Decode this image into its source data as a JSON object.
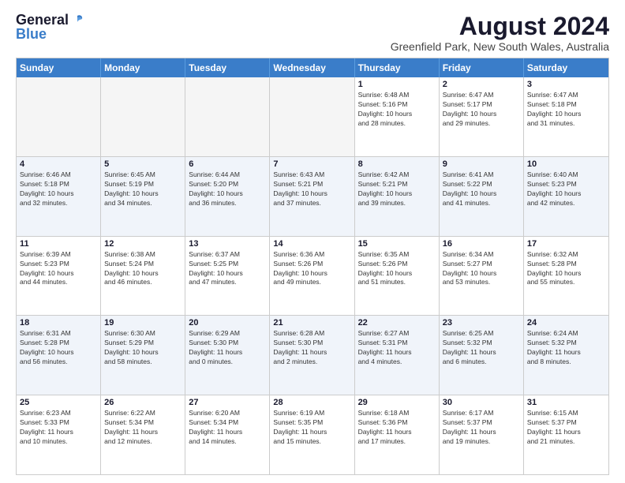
{
  "logo": {
    "general": "General",
    "blue": "Blue"
  },
  "title": "August 2024",
  "subtitle": "Greenfield Park, New South Wales, Australia",
  "headers": [
    "Sunday",
    "Monday",
    "Tuesday",
    "Wednesday",
    "Thursday",
    "Friday",
    "Saturday"
  ],
  "weeks": [
    [
      {
        "day": "",
        "info": "",
        "empty": true
      },
      {
        "day": "",
        "info": "",
        "empty": true
      },
      {
        "day": "",
        "info": "",
        "empty": true
      },
      {
        "day": "",
        "info": "",
        "empty": true
      },
      {
        "day": "1",
        "info": "Sunrise: 6:48 AM\nSunset: 5:16 PM\nDaylight: 10 hours\nand 28 minutes.",
        "empty": false
      },
      {
        "day": "2",
        "info": "Sunrise: 6:47 AM\nSunset: 5:17 PM\nDaylight: 10 hours\nand 29 minutes.",
        "empty": false
      },
      {
        "day": "3",
        "info": "Sunrise: 6:47 AM\nSunset: 5:18 PM\nDaylight: 10 hours\nand 31 minutes.",
        "empty": false
      }
    ],
    [
      {
        "day": "4",
        "info": "Sunrise: 6:46 AM\nSunset: 5:18 PM\nDaylight: 10 hours\nand 32 minutes.",
        "empty": false
      },
      {
        "day": "5",
        "info": "Sunrise: 6:45 AM\nSunset: 5:19 PM\nDaylight: 10 hours\nand 34 minutes.",
        "empty": false
      },
      {
        "day": "6",
        "info": "Sunrise: 6:44 AM\nSunset: 5:20 PM\nDaylight: 10 hours\nand 36 minutes.",
        "empty": false
      },
      {
        "day": "7",
        "info": "Sunrise: 6:43 AM\nSunset: 5:21 PM\nDaylight: 10 hours\nand 37 minutes.",
        "empty": false
      },
      {
        "day": "8",
        "info": "Sunrise: 6:42 AM\nSunset: 5:21 PM\nDaylight: 10 hours\nand 39 minutes.",
        "empty": false
      },
      {
        "day": "9",
        "info": "Sunrise: 6:41 AM\nSunset: 5:22 PM\nDaylight: 10 hours\nand 41 minutes.",
        "empty": false
      },
      {
        "day": "10",
        "info": "Sunrise: 6:40 AM\nSunset: 5:23 PM\nDaylight: 10 hours\nand 42 minutes.",
        "empty": false
      }
    ],
    [
      {
        "day": "11",
        "info": "Sunrise: 6:39 AM\nSunset: 5:23 PM\nDaylight: 10 hours\nand 44 minutes.",
        "empty": false
      },
      {
        "day": "12",
        "info": "Sunrise: 6:38 AM\nSunset: 5:24 PM\nDaylight: 10 hours\nand 46 minutes.",
        "empty": false
      },
      {
        "day": "13",
        "info": "Sunrise: 6:37 AM\nSunset: 5:25 PM\nDaylight: 10 hours\nand 47 minutes.",
        "empty": false
      },
      {
        "day": "14",
        "info": "Sunrise: 6:36 AM\nSunset: 5:26 PM\nDaylight: 10 hours\nand 49 minutes.",
        "empty": false
      },
      {
        "day": "15",
        "info": "Sunrise: 6:35 AM\nSunset: 5:26 PM\nDaylight: 10 hours\nand 51 minutes.",
        "empty": false
      },
      {
        "day": "16",
        "info": "Sunrise: 6:34 AM\nSunset: 5:27 PM\nDaylight: 10 hours\nand 53 minutes.",
        "empty": false
      },
      {
        "day": "17",
        "info": "Sunrise: 6:32 AM\nSunset: 5:28 PM\nDaylight: 10 hours\nand 55 minutes.",
        "empty": false
      }
    ],
    [
      {
        "day": "18",
        "info": "Sunrise: 6:31 AM\nSunset: 5:28 PM\nDaylight: 10 hours\nand 56 minutes.",
        "empty": false
      },
      {
        "day": "19",
        "info": "Sunrise: 6:30 AM\nSunset: 5:29 PM\nDaylight: 10 hours\nand 58 minutes.",
        "empty": false
      },
      {
        "day": "20",
        "info": "Sunrise: 6:29 AM\nSunset: 5:30 PM\nDaylight: 11 hours\nand 0 minutes.",
        "empty": false
      },
      {
        "day": "21",
        "info": "Sunrise: 6:28 AM\nSunset: 5:30 PM\nDaylight: 11 hours\nand 2 minutes.",
        "empty": false
      },
      {
        "day": "22",
        "info": "Sunrise: 6:27 AM\nSunset: 5:31 PM\nDaylight: 11 hours\nand 4 minutes.",
        "empty": false
      },
      {
        "day": "23",
        "info": "Sunrise: 6:25 AM\nSunset: 5:32 PM\nDaylight: 11 hours\nand 6 minutes.",
        "empty": false
      },
      {
        "day": "24",
        "info": "Sunrise: 6:24 AM\nSunset: 5:32 PM\nDaylight: 11 hours\nand 8 minutes.",
        "empty": false
      }
    ],
    [
      {
        "day": "25",
        "info": "Sunrise: 6:23 AM\nSunset: 5:33 PM\nDaylight: 11 hours\nand 10 minutes.",
        "empty": false
      },
      {
        "day": "26",
        "info": "Sunrise: 6:22 AM\nSunset: 5:34 PM\nDaylight: 11 hours\nand 12 minutes.",
        "empty": false
      },
      {
        "day": "27",
        "info": "Sunrise: 6:20 AM\nSunset: 5:34 PM\nDaylight: 11 hours\nand 14 minutes.",
        "empty": false
      },
      {
        "day": "28",
        "info": "Sunrise: 6:19 AM\nSunset: 5:35 PM\nDaylight: 11 hours\nand 15 minutes.",
        "empty": false
      },
      {
        "day": "29",
        "info": "Sunrise: 6:18 AM\nSunset: 5:36 PM\nDaylight: 11 hours\nand 17 minutes.",
        "empty": false
      },
      {
        "day": "30",
        "info": "Sunrise: 6:17 AM\nSunset: 5:37 PM\nDaylight: 11 hours\nand 19 minutes.",
        "empty": false
      },
      {
        "day": "31",
        "info": "Sunrise: 6:15 AM\nSunset: 5:37 PM\nDaylight: 11 hours\nand 21 minutes.",
        "empty": false
      }
    ]
  ]
}
